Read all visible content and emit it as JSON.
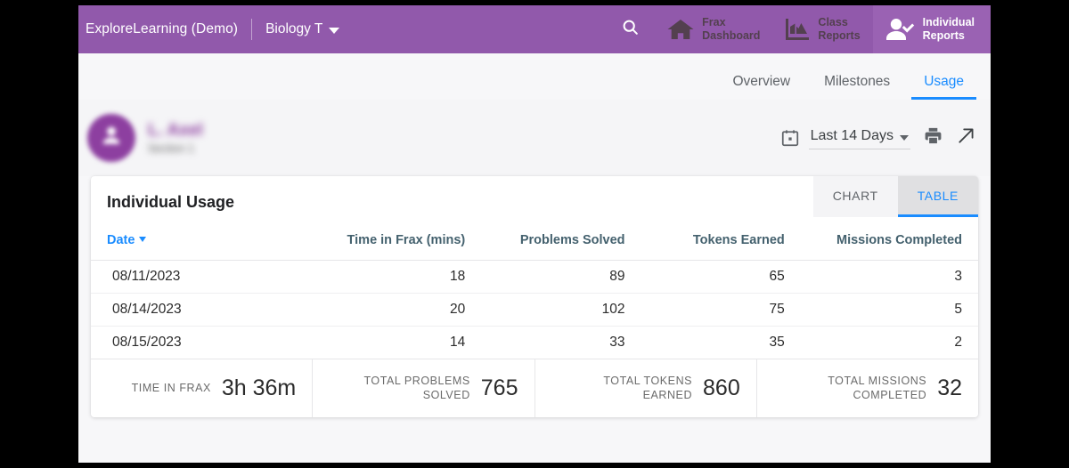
{
  "topbar": {
    "brand": "ExploreLearning (Demo)",
    "course": "Biology T",
    "search_icon": "search-icon",
    "nav": [
      {
        "label": "Frax\nDashboard",
        "icon": "home-icon",
        "active": false
      },
      {
        "label": "Class\nReports",
        "icon": "bar-chart-icon",
        "active": false
      },
      {
        "label": "Individual\nReports",
        "icon": "person-check-icon",
        "active": true
      }
    ]
  },
  "subtabs": [
    {
      "label": "Overview",
      "active": false
    },
    {
      "label": "Milestones",
      "active": false
    },
    {
      "label": "Usage",
      "active": true
    }
  ],
  "student": {
    "name": "L. Axel",
    "section": "Section 1",
    "avatar_icon": "person-avatar-icon"
  },
  "toolbar": {
    "calendar_icon": "calendar-icon",
    "date_range": "Last 14 Days",
    "print_icon": "printer-icon",
    "export_icon": "external-link-arrow-icon"
  },
  "card": {
    "title": "Individual Usage",
    "toggle": [
      {
        "label": "CHART",
        "active": false
      },
      {
        "label": "TABLE",
        "active": true
      }
    ]
  },
  "table": {
    "sort_column": "Date",
    "sort_direction": "desc",
    "columns": [
      "Date",
      "Time in Frax (mins)",
      "Problems Solved",
      "Tokens Earned",
      "Missions Completed"
    ],
    "rows": [
      [
        "08/11/2023",
        "18",
        "89",
        "65",
        "3"
      ],
      [
        "08/14/2023",
        "20",
        "102",
        "75",
        "5"
      ],
      [
        "08/15/2023",
        "14",
        "33",
        "35",
        "2"
      ]
    ]
  },
  "summary": [
    {
      "label": "TIME IN FRAX",
      "value": "3h 36m"
    },
    {
      "label": "TOTAL PROBLEMS\nSOLVED",
      "value": "765"
    },
    {
      "label": "TOTAL TOKENS\nEARNED",
      "value": "860"
    },
    {
      "label": "TOTAL MISSIONS\nCOMPLETED",
      "value": "32"
    }
  ],
  "colors": {
    "brand_purple": "#9159ab",
    "active_tab_purple": "#9a62b3",
    "accent_blue": "#1a8cff",
    "header_slate": "#44616e",
    "avatar_purple": "#8d3fa0"
  }
}
